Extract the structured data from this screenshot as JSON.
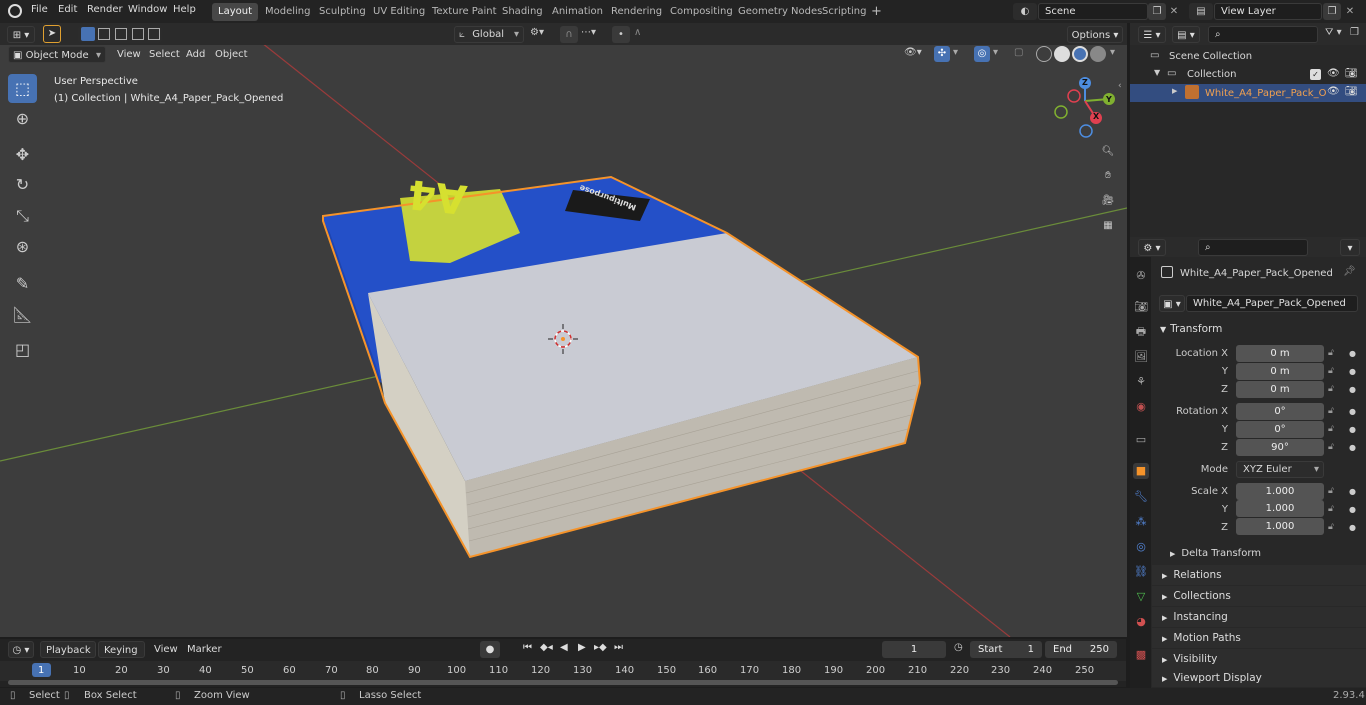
{
  "menubar": {
    "items": [
      "File",
      "Edit",
      "Render",
      "Window",
      "Help"
    ],
    "workspaces": [
      "Layout",
      "Modeling",
      "Sculpting",
      "UV Editing",
      "Texture Paint",
      "Shading",
      "Animation",
      "Rendering",
      "Compositing",
      "Geometry Nodes",
      "Scripting"
    ],
    "active_workspace": "Layout",
    "add_tab": "+",
    "scene": "Scene",
    "view_layer": "View Layer"
  },
  "viewport_header": {
    "mode": "Object Mode",
    "menus": [
      "View",
      "Select",
      "Add",
      "Object"
    ],
    "orientation": "Global",
    "options": "Options"
  },
  "viewport": {
    "perspective": "User Perspective",
    "collection_info": "(1) Collection | White_A4_Paper_Pack_Opened",
    "box_text": "A4",
    "box_badge": "Multipurpose",
    "gizmo": {
      "z": "Z",
      "y": "Y",
      "x": "X"
    }
  },
  "outliner": {
    "scene_collection": "Scene Collection",
    "collection": "Collection",
    "object": "White_A4_Paper_Pack_O"
  },
  "properties": {
    "object_name": "White_A4_Paper_Pack_Opened",
    "object_field": "White_A4_Paper_Pack_Opened",
    "transform_title": "Transform",
    "location_label": "Location X",
    "rotation_label": "Rotation X",
    "scale_label": "Scale X",
    "y_label": "Y",
    "z_label": "Z",
    "location": [
      "0 m",
      "0 m",
      "0 m"
    ],
    "rotation": [
      "0°",
      "0°",
      "90°"
    ],
    "mode_label": "Mode",
    "mode_value": "XYZ Euler",
    "scale": [
      "1.000",
      "1.000",
      "1.000"
    ],
    "delta_transform": "Delta Transform",
    "panels": [
      "Relations",
      "Collections",
      "Instancing",
      "Motion Paths",
      "Visibility",
      "Viewport Display"
    ]
  },
  "timeline": {
    "menus": [
      "Playback",
      "Keying",
      "View",
      "Marker"
    ],
    "current_frame": "1",
    "start_label": "Start",
    "start": "1",
    "end_label": "End",
    "end": "250",
    "ruler": [
      "1",
      "10",
      "20",
      "30",
      "40",
      "50",
      "60",
      "70",
      "80",
      "90",
      "100",
      "110",
      "120",
      "130",
      "140",
      "150",
      "160",
      "170",
      "180",
      "190",
      "200",
      "210",
      "220",
      "230",
      "240",
      "250"
    ]
  },
  "statusbar": {
    "select": "Select",
    "box_select": "Box Select",
    "zoom_view": "Zoom View",
    "lasso_select": "Lasso Select",
    "version": "2.93.4"
  },
  "colors": {
    "accent": "#4772b3",
    "selection": "#f5932a",
    "box_blue": "#2450c8",
    "box_yellow": "#d6e030"
  }
}
